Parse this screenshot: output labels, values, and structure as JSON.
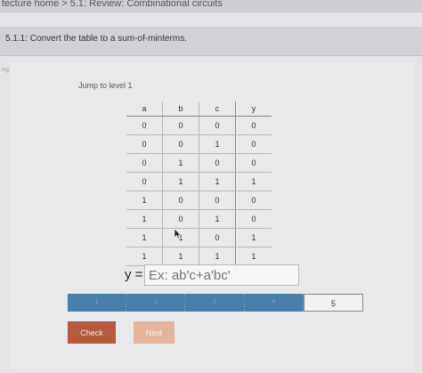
{
  "breadcrumb": {
    "text": "tecture home > 5.1: Review: Combinational circuits"
  },
  "header": {
    "title": "5.1.1: Convert the table to a sum-of-minterms."
  },
  "sidebar": {
    "corner_label": "ing t"
  },
  "activity": {
    "jump_label": "Jump to level 1",
    "table": {
      "headers": [
        "a",
        "b",
        "c",
        "y"
      ],
      "rows": [
        [
          "0",
          "0",
          "0",
          "0"
        ],
        [
          "0",
          "0",
          "1",
          "0"
        ],
        [
          "0",
          "1",
          "0",
          "0"
        ],
        [
          "0",
          "1",
          "1",
          "1"
        ],
        [
          "1",
          "0",
          "0",
          "0"
        ],
        [
          "1",
          "0",
          "1",
          "0"
        ],
        [
          "1",
          "1",
          "0",
          "1"
        ],
        [
          "1",
          "1",
          "1",
          "1"
        ]
      ]
    },
    "equation_prefix": "y =",
    "answer": {
      "value": "",
      "placeholder": "Ex: ab'c+a'bc'"
    },
    "levels": [
      "1",
      "2",
      "3",
      "4",
      "5"
    ],
    "current_level": 5,
    "check_label": "Check",
    "next_label": "Next"
  },
  "colors": {
    "check": "#b65a3e",
    "next": "#e3b59b",
    "level_bar": "#4a7fa9"
  }
}
